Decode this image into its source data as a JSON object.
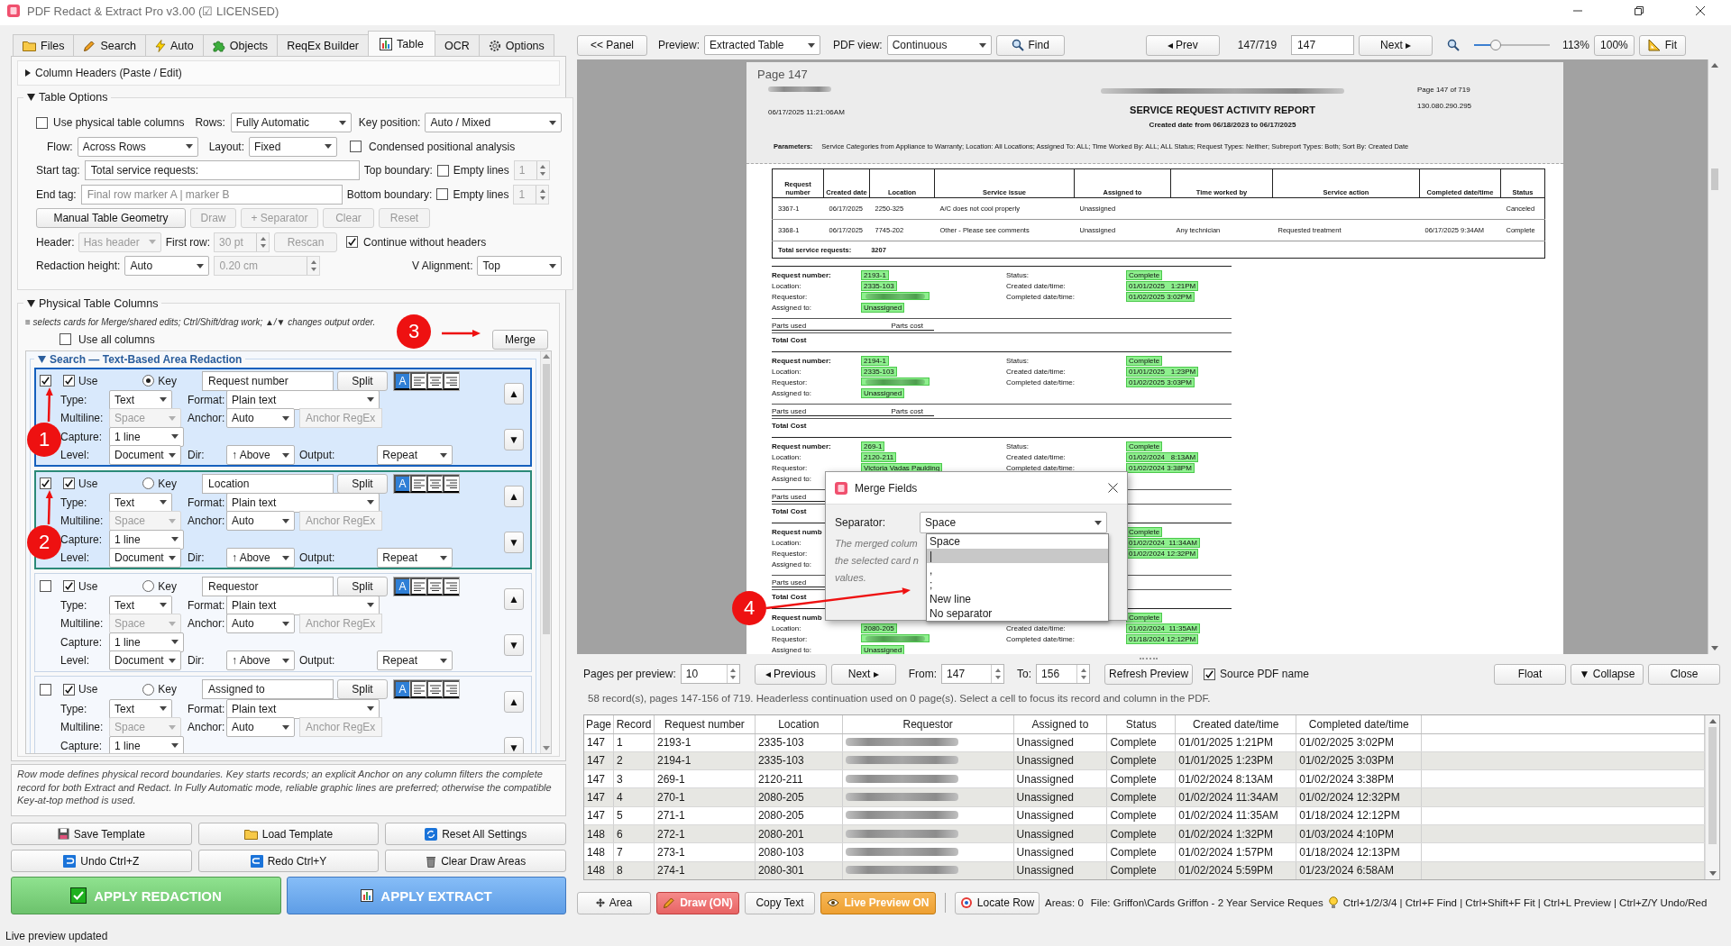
{
  "window": {
    "title": "PDF Redact & Extract Pro v3.00 (☑ LICENSED)"
  },
  "tabs": [
    {
      "label": "Files",
      "selected": false
    },
    {
      "label": "Search",
      "selected": false
    },
    {
      "label": "Auto",
      "selected": false
    },
    {
      "label": "Objects",
      "selected": false
    },
    {
      "label": "ReqEx Builder",
      "selected": false
    },
    {
      "label": "Table",
      "selected": true
    },
    {
      "label": "OCR",
      "selected": false
    },
    {
      "label": "Options",
      "selected": false
    }
  ],
  "left_panel": {
    "column_headers": {
      "title": "Column Headers (Paste / Edit)",
      "expanded": false
    },
    "table_options": {
      "title": "Table Options",
      "expanded": true,
      "use_physical_columns": {
        "label": "Use physical table columns",
        "checked": false
      },
      "rows": {
        "label": "Rows:",
        "value": "Fully Automatic"
      },
      "key_position": {
        "label": "Key position:",
        "value": "Auto / Mixed"
      },
      "flow": {
        "label": "Flow:",
        "value": "Across Rows"
      },
      "layout": {
        "label": "Layout:",
        "value": "Fixed"
      },
      "condensed": {
        "label": "Condensed positional analysis",
        "checked": false
      },
      "start_tag": {
        "label": "Start tag:",
        "value": "Total service requests:"
      },
      "top_boundary": {
        "label": "Top boundary:",
        "checked": false
      },
      "top_empty_lines": {
        "label": "Empty lines",
        "value": "1",
        "disabled": true
      },
      "end_tag": {
        "label": "End tag:",
        "placeholder": "Final row marker A | marker B"
      },
      "bottom_boundary": {
        "label": "Bottom boundary:",
        "checked": false
      },
      "bottom_empty_lines": {
        "label": "Empty lines",
        "value": "1",
        "disabled": true
      },
      "geometry_buttons": [
        {
          "label": "Manual Table Geometry",
          "disabled": false
        },
        {
          "label": "Draw",
          "disabled": true
        },
        {
          "label": "+ Separator",
          "disabled": true
        },
        {
          "label": "Clear",
          "disabled": true
        },
        {
          "label": "Reset",
          "disabled": true
        }
      ],
      "header": {
        "label": "Header:",
        "value": "Has header",
        "disabled": true
      },
      "first_row": {
        "label": "First row:",
        "value": "30 pt",
        "disabled": true
      },
      "rescan": {
        "label": "Rescan",
        "disabled": true
      },
      "continue_without_headers": {
        "label": "Continue without headers",
        "checked": true
      },
      "redaction_height": {
        "label": "Redaction height:",
        "value": "Auto"
      },
      "redaction_size": {
        "value": "0.20 cm",
        "disabled": true
      },
      "v_alignment": {
        "label": "V Alignment:",
        "value": "Top"
      }
    },
    "physical_columns": {
      "title": "Physical Table Columns",
      "expanded": true,
      "hint": "≡ selects cards for Merge/shared edits; Ctrl/Shift/drag work; ▲/▼ changes output order.",
      "use_all": {
        "label": "Use all columns",
        "checked": false
      },
      "merge": "Merge",
      "group_title": "Search — Text-Based Area Redaction",
      "group_expanded": true,
      "cards": [
        {
          "selected": true,
          "focused": true,
          "use": {
            "label": "Use",
            "checked": true
          },
          "key": {
            "label": "Key",
            "selected": true
          },
          "name": "Request number",
          "split": "Split",
          "align": [
            {
              "kind": "auto",
              "label": "A",
              "selected": true
            },
            {
              "kind": "left",
              "selected": false
            },
            {
              "kind": "center",
              "selected": false
            },
            {
              "kind": "right",
              "selected": false
            }
          ],
          "type": {
            "label": "Type:",
            "value": "Text"
          },
          "format": {
            "label": "Format:",
            "value": "Plain text"
          },
          "multiline": {
            "label": "Multiline:",
            "value": "Space",
            "disabled": true
          },
          "anchor": {
            "label": "Anchor:",
            "value": "Auto"
          },
          "anchor_regex": {
            "placeholder": "Anchor RegEx",
            "disabled": true
          },
          "capture": {
            "label": "Capture:",
            "value": "1 line"
          },
          "level": {
            "label": "Level:",
            "value": "Document"
          },
          "dir": {
            "label": "Dir:",
            "value": "↑ Above"
          },
          "output": {
            "label": "Output:",
            "value": "Repeat"
          },
          "up": "▲",
          "down": "▼"
        },
        {
          "selected": true,
          "focused": false,
          "use": {
            "label": "Use",
            "checked": true
          },
          "key": {
            "label": "Key",
            "selected": false
          },
          "name": "Location",
          "split": "Split",
          "align": [
            {
              "kind": "auto",
              "label": "A",
              "selected": true
            },
            {
              "kind": "left",
              "selected": false
            },
            {
              "kind": "center",
              "selected": false
            },
            {
              "kind": "right",
              "selected": false
            }
          ],
          "type": {
            "label": "Type:",
            "value": "Text"
          },
          "format": {
            "label": "Format:",
            "value": "Plain text"
          },
          "multiline": {
            "label": "Multiline:",
            "value": "Space",
            "disabled": true
          },
          "anchor": {
            "label": "Anchor:",
            "value": "Auto"
          },
          "anchor_regex": {
            "placeholder": "Anchor RegEx",
            "disabled": true
          },
          "capture": {
            "label": "Capture:",
            "value": "1 line"
          },
          "level": {
            "label": "Level:",
            "value": "Document"
          },
          "dir": {
            "label": "Dir:",
            "value": "↑ Above"
          },
          "output": {
            "label": "Output:",
            "value": "Repeat"
          },
          "up": "▲",
          "down": "▼"
        },
        {
          "selected": false,
          "focused": false,
          "use": {
            "label": "Use",
            "checked": true
          },
          "key": {
            "label": "Key",
            "selected": false
          },
          "name": "Requestor",
          "split": "Split",
          "align": [
            {
              "kind": "auto",
              "label": "A",
              "selected": true
            },
            {
              "kind": "left",
              "selected": false
            },
            {
              "kind": "center",
              "selected": false
            },
            {
              "kind": "right",
              "selected": false
            }
          ],
          "type": {
            "label": "Type:",
            "value": "Text"
          },
          "format": {
            "label": "Format:",
            "value": "Plain text"
          },
          "multiline": {
            "label": "Multiline:",
            "value": "Space",
            "disabled": true
          },
          "anchor": {
            "label": "Anchor:",
            "value": "Auto"
          },
          "anchor_regex": {
            "placeholder": "Anchor RegEx",
            "disabled": true
          },
          "capture": {
            "label": "Capture:",
            "value": "1 line"
          },
          "level": {
            "label": "Level:",
            "value": "Document"
          },
          "dir": {
            "label": "Dir:",
            "value": "↑ Above"
          },
          "output": {
            "label": "Output:",
            "value": "Repeat"
          },
          "up": "▲",
          "down": "▼"
        },
        {
          "selected": false,
          "focused": false,
          "use": {
            "label": "Use",
            "checked": true
          },
          "key": {
            "label": "Key",
            "selected": false
          },
          "name": "Assigned to",
          "split": "Split",
          "align": [
            {
              "kind": "auto",
              "label": "A",
              "selected": true
            },
            {
              "kind": "left",
              "selected": false
            },
            {
              "kind": "center",
              "selected": false
            },
            {
              "kind": "right",
              "selected": false
            }
          ],
          "type": {
            "label": "Type:",
            "value": "Text"
          },
          "format": {
            "label": "Format:",
            "value": "Plain text"
          },
          "multiline": {
            "label": "Multiline:",
            "value": "Space",
            "disabled": true
          },
          "anchor": {
            "label": "Anchor:",
            "value": "Auto"
          },
          "anchor_regex": {
            "placeholder": "Anchor RegEx",
            "disabled": true
          },
          "capture": {
            "label": "Capture:",
            "value": "1 line"
          },
          "up": "▲",
          "down": "▼"
        }
      ]
    },
    "note": "Row mode defines physical record boundaries. Key starts records; an explicit Anchor on any column filters the complete record for both Extract and Redact. In Fully Automatic mode, reliable graphic lines are preferred; otherwise the compatible Key-at-top method is used.",
    "template_buttons": [
      "Save Template",
      "Load Template",
      "Reset All Settings",
      "Undo  Ctrl+Z",
      "Redo  Ctrl+Y",
      "Clear Draw Areas"
    ],
    "apply_buttons": [
      {
        "label": "APPLY REDACTION",
        "kind": "redact"
      },
      {
        "label": "APPLY EXTRACT",
        "kind": "extract"
      }
    ]
  },
  "toolbar": {
    "panel_button": "<< Panel",
    "preview": {
      "label": "Preview:",
      "value": "Extracted Table"
    },
    "pdf_view": {
      "label": "PDF view:",
      "value": "Continuous"
    },
    "find": "Find",
    "prev": "◂ Prev",
    "page_count": "147/719",
    "page_input": "147",
    "next": "Next ▸",
    "zoom": {
      "level": 0.28,
      "reading": "113%"
    },
    "zoom_reset": "100%",
    "fit": "Fit"
  },
  "pdf": {
    "page_label": "Page 147",
    "timestamp": "06/17/2025  11:21:06AM",
    "title": "SERVICE REQUEST ACTIVITY REPORT",
    "subtitle": "Created date from 06/18/2023 to 06/17/2025",
    "page_of": "Page 147 of 719",
    "code": "130.080.290.295",
    "parameters_label": "Parameters:",
    "parameters": "Service Categories from Appliance to Warranty; Location: All Locations; Assigned To: ALL; Time Worked By: ALL; ALL Status; Request Types: Neither; Subreport Types: Both; Sort By: Created Date",
    "table": {
      "columns": [
        "Request number",
        "Created date",
        "Location",
        "Service issue",
        "Assigned to",
        "Time worked by",
        "Service action",
        "Completed date/time",
        "Status"
      ],
      "rows": [
        [
          "3367-1",
          "06/17/2025",
          "2250-325",
          "A/C does not cool properly",
          "Unassigned",
          null,
          null,
          null,
          "Canceled"
        ],
        [
          "3368-1",
          "06/17/2025",
          "7745-202",
          "Other - Please see comments",
          "Unassigned",
          "Any technician",
          "Requested treatment",
          "06/17/2025 9:34AM",
          "Complete"
        ]
      ],
      "total_label": "Total service requests:",
      "total": "3207"
    },
    "records": [
      {
        "left": [
          {
            "label": "Request number:",
            "value": "2193-1"
          },
          {
            "label": "Location:",
            "value": "2335-103"
          },
          {
            "label": "Requestor:",
            "blurred": true
          },
          {
            "label": "Assigned to:",
            "value": "Unassigned"
          }
        ],
        "right": [
          {
            "label": "Status:",
            "value": "Complete"
          },
          {
            "label": "Created date/time:",
            "value": "01/01/2025   1:21PM"
          },
          {
            "label": "Completed date/time:",
            "value": "01/02/2025 3:02PM"
          }
        ],
        "parts_used": "Parts used",
        "parts_cost": "Parts cost",
        "total_cost": "Total Cost"
      },
      {
        "left": [
          {
            "label": "Request number:",
            "value": "2194-1"
          },
          {
            "label": "Location:",
            "value": "2335-103"
          },
          {
            "label": "Requestor:",
            "blurred": true
          },
          {
            "label": "Assigned to:",
            "value": "Unassigned"
          }
        ],
        "right": [
          {
            "label": "Status:",
            "value": "Complete"
          },
          {
            "label": "Created date/time:",
            "value": "01/01/2025   1:23PM"
          },
          {
            "label": "Completed date/time:",
            "value": "01/02/2025 3:03PM"
          }
        ],
        "parts_used": "Parts used",
        "parts_cost": "Parts cost",
        "total_cost": "Total Cost"
      },
      {
        "left": [
          {
            "label": "Request number:",
            "value": "269-1"
          },
          {
            "label": "Location:",
            "value": "2120-211"
          },
          {
            "label": "Requestor:",
            "value": "Victoria Vadas Paulding"
          },
          {
            "label": "Assigned to:"
          }
        ],
        "right": [
          {
            "label": "Status:",
            "value": "Complete"
          },
          {
            "label": "Created date/time:",
            "value": "01/02/2024   8:13AM"
          },
          {
            "label": "Completed date/time:",
            "value": "01/02/2024 3:38PM"
          }
        ],
        "parts_used": "Parts used",
        "total_cost": "Total Cost"
      },
      {
        "left": [
          {
            "label": "Request numb"
          },
          {
            "label": "Location:"
          },
          {
            "label": "Requestor:"
          },
          {
            "label": "Assigned to:"
          }
        ],
        "right": [
          {
            "value": "Complete"
          },
          {
            "value": "01/02/2024  11:34AM"
          },
          {
            "value": "01/02/2024 12:32PM"
          }
        ],
        "parts_used": "Parts used",
        "total_cost": "Total Cost"
      },
      {
        "left": [
          {
            "label": "Request numb"
          },
          {
            "label": "Location:",
            "value": "2080-205"
          },
          {
            "label": "Requestor:",
            "blurred": true
          },
          {
            "label": "Assigned to:",
            "value": "Unassigned"
          }
        ],
        "right": [
          {
            "value": "Complete"
          },
          {
            "label": "Created date/time:",
            "value": "01/02/2024  11:35AM"
          },
          {
            "label": "Completed date/time:",
            "value": "01/18/2024 12:12PM"
          }
        ]
      }
    ]
  },
  "merge_dialog": {
    "title": "Merge Fields",
    "separator": {
      "label": "Separator:",
      "value": "Space",
      "expanded": true,
      "options": [
        {
          "label": "Space",
          "highlighted": false
        },
        {
          "label": "|",
          "highlighted": true
        },
        {
          "label": ",",
          "highlighted": false
        },
        {
          "label": ";",
          "highlighted": false
        },
        {
          "label": "New line",
          "highlighted": false
        },
        {
          "label": "No separator",
          "highlighted": false
        }
      ]
    },
    "description_lines": [
      "The merged colum",
      "the selected card n",
      "values."
    ]
  },
  "preview_controls": {
    "pages_per_preview": {
      "label": "Pages per preview:",
      "value": "10"
    },
    "previous": "◂ Previous",
    "next": "Next ▸",
    "from": {
      "label": "From:",
      "value": "147"
    },
    "to": {
      "label": "To:",
      "value": "156"
    },
    "refresh": "Refresh Preview",
    "source_pdf_name": {
      "label": "Source PDF name",
      "checked": true
    },
    "float": "Float",
    "collapse": "▼ Collapse",
    "close": "Close"
  },
  "summary": "58 record(s), pages 147-156 of 719. Headerless continuation used on 0 page(s). Select a cell to focus its record and column in the PDF.",
  "results": {
    "columns": [
      "Page",
      "Record",
      "Request number",
      "Location",
      "Requestor",
      "Assigned to",
      "Status",
      "Created date/time",
      "Completed date/time"
    ],
    "rows": [
      {
        "cells": [
          "147",
          "1",
          "2193-1",
          "2335-103",
          null,
          "Unassigned",
          "Complete",
          "01/01/2025 1:21PM",
          "01/02/2025 3:02PM"
        ],
        "requestor_blurred": true
      },
      {
        "cells": [
          "147",
          "2",
          "2194-1",
          "2335-103",
          null,
          "Unassigned",
          "Complete",
          "01/01/2025 1:23PM",
          "01/02/2025 3:03PM"
        ],
        "requestor_blurred": true
      },
      {
        "cells": [
          "147",
          "3",
          "269-1",
          "2120-211",
          null,
          "Unassigned",
          "Complete",
          "01/02/2024 8:13AM",
          "01/02/2024 3:38PM"
        ],
        "requestor_blurred": true
      },
      {
        "cells": [
          "147",
          "4",
          "270-1",
          "2080-205",
          null,
          "Unassigned",
          "Complete",
          "01/02/2024 11:34AM",
          "01/02/2024 12:32PM"
        ],
        "requestor_blurred": true
      },
      {
        "cells": [
          "147",
          "5",
          "271-1",
          "2080-205",
          null,
          "Unassigned",
          "Complete",
          "01/02/2024 11:35AM",
          "01/18/2024 12:12PM"
        ],
        "requestor_blurred": true
      },
      {
        "cells": [
          "148",
          "6",
          "272-1",
          "2080-201",
          null,
          "Unassigned",
          "Complete",
          "01/02/2024 1:32PM",
          "01/03/2024 4:10PM"
        ],
        "requestor_blurred": true
      },
      {
        "cells": [
          "148",
          "7",
          "273-1",
          "2080-103",
          null,
          "Unassigned",
          "Complete",
          "01/02/2024 1:57PM",
          "01/18/2024 12:13PM"
        ],
        "requestor_blurred": true
      },
      {
        "cells": [
          "148",
          "8",
          "274-1",
          "2080-301",
          null,
          "Unassigned",
          "Complete",
          "01/02/2024 5:59PM",
          "01/23/2024 6:58AM"
        ],
        "requestor_blurred": true
      }
    ]
  },
  "bottom_toolbar": {
    "area": "Area",
    "draw": {
      "label": "Draw (ON)",
      "on": true
    },
    "copy_text": "Copy Text",
    "live_preview": {
      "label": "Live Preview ON",
      "on": true
    },
    "locate_row": "Locate Row",
    "areas": "Areas: 0",
    "file": "File: Griffon\\Cards Griffon - 2 Year Service Reques",
    "shortcuts": "Ctrl+1/2/3/4 | Ctrl+F Find | Ctrl+Shift+F Fit | Ctrl+L Preview | Ctrl+Z/Y Undo/Red"
  },
  "status": "Live preview updated",
  "annotations": [
    {
      "number": "1"
    },
    {
      "number": "2"
    },
    {
      "number": "3"
    },
    {
      "number": "4"
    }
  ]
}
